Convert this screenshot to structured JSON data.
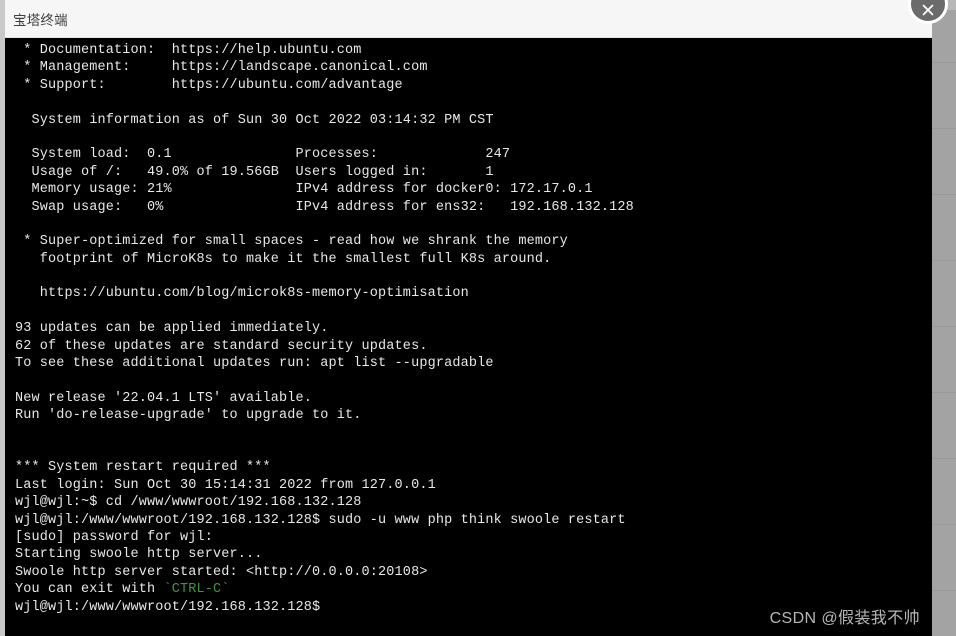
{
  "window": {
    "title": "宝塔终端",
    "close_label": "×",
    "close_icon": "chevron-up-icon"
  },
  "scrollbar": {
    "notch_positions": [
      62,
      128,
      194,
      260,
      326,
      392,
      458,
      524,
      590
    ]
  },
  "watermark": {
    "text": "CSDN @假装我不帅"
  },
  "terminal": {
    "colors": {
      "background": "#000000",
      "foreground": "#e8e8e8",
      "green": "#3a9a3a"
    },
    "lines": [
      {
        "text": " * Documentation:  https://help.ubuntu.com"
      },
      {
        "text": " * Management:     https://landscape.canonical.com"
      },
      {
        "text": " * Support:        https://ubuntu.com/advantage"
      },
      {
        "text": ""
      },
      {
        "text": "  System information as of Sun 30 Oct 2022 03:14:32 PM CST"
      },
      {
        "text": ""
      },
      {
        "text": "  System load:  0.1               Processes:             247"
      },
      {
        "text": "  Usage of /:   49.0% of 19.56GB  Users logged in:       1"
      },
      {
        "text": "  Memory usage: 21%               IPv4 address for docker0: 172.17.0.1"
      },
      {
        "text": "  Swap usage:   0%                IPv4 address for ens32:   192.168.132.128"
      },
      {
        "text": ""
      },
      {
        "text": " * Super-optimized for small spaces - read how we shrank the memory"
      },
      {
        "text": "   footprint of MicroK8s to make it the smallest full K8s around."
      },
      {
        "text": ""
      },
      {
        "text": "   https://ubuntu.com/blog/microk8s-memory-optimisation"
      },
      {
        "text": ""
      },
      {
        "text": "93 updates can be applied immediately."
      },
      {
        "text": "62 of these updates are standard security updates."
      },
      {
        "text": "To see these additional updates run: apt list --upgradable"
      },
      {
        "text": ""
      },
      {
        "text": "New release '22.04.1 LTS' available."
      },
      {
        "text": "Run 'do-release-upgrade' to upgrade to it."
      },
      {
        "text": ""
      },
      {
        "text": ""
      },
      {
        "text": "*** System restart required ***"
      },
      {
        "text": "Last login: Sun Oct 30 15:14:31 2022 from 127.0.0.1"
      },
      {
        "text": "wjl@wjl:~$ cd /www/wwwroot/192.168.132.128"
      },
      {
        "text": "wjl@wjl:/www/wwwroot/192.168.132.128$ sudo -u www php think swoole restart"
      },
      {
        "text": "[sudo] password for wjl:"
      },
      {
        "text": "Starting swoole http server..."
      },
      {
        "text": "Swoole http server started: <http://0.0.0.0:20108>"
      },
      {
        "text": "You can exit with ",
        "suffix": "`CTRL-C`",
        "suffix_class": "grn"
      },
      {
        "text": "wjl@wjl:/www/wwwroot/192.168.132.128$"
      }
    ]
  }
}
